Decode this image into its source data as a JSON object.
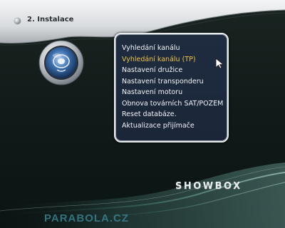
{
  "header": {
    "title": "2. Instalace"
  },
  "menu": {
    "selected_index": 1,
    "items": [
      {
        "label": "Vyhledání kanálu"
      },
      {
        "label": "Vyhledání kanálu (TP)"
      },
      {
        "label": "Nastavení družice"
      },
      {
        "label": "Nastavení transponderu"
      },
      {
        "label": "Nastavení motoru"
      },
      {
        "label": "Obnova továrních SAT/POZEM"
      },
      {
        "label": "Reset databáze."
      },
      {
        "label": "Aktualizace přijímače"
      }
    ]
  },
  "brand": {
    "logo_text": "SHOWBOX"
  },
  "watermark": {
    "text": "PARABOLA.CZ"
  },
  "colors": {
    "selected_item": "#ecc24a",
    "menu_background": "#1d293c",
    "screen_background": "#101a18"
  },
  "icons": {
    "title_bullet": "bullet-icon",
    "dial": "installation-dial-icon",
    "cursor": "mouse-pointer-icon"
  }
}
